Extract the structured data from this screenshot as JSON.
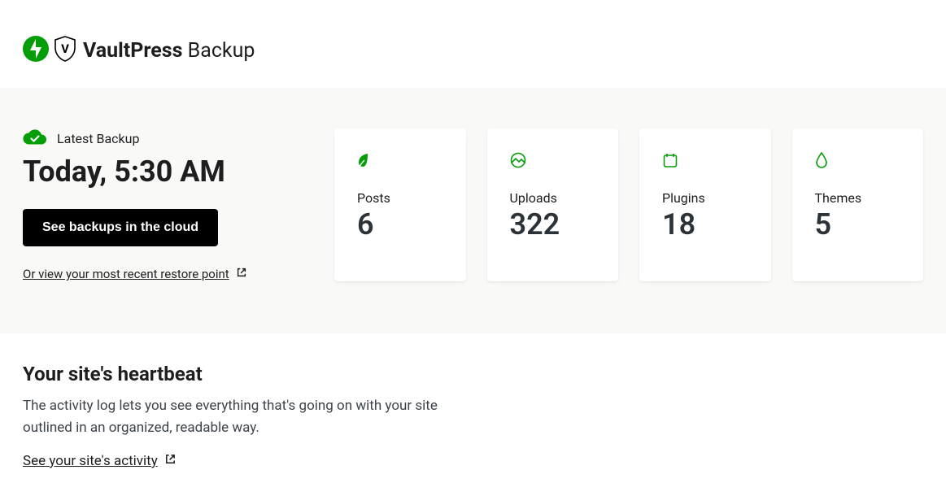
{
  "header": {
    "brand_bold": "VaultPress",
    "brand_light": " Backup"
  },
  "backup": {
    "latest_label": "Latest Backup",
    "timestamp": "Today, 5:30 AM",
    "cta_label": "See backups in the cloud",
    "restore_link": "Or view your most recent restore point"
  },
  "stats": [
    {
      "icon": "posts",
      "label": "Posts",
      "value": "6"
    },
    {
      "icon": "uploads",
      "label": "Uploads",
      "value": "322"
    },
    {
      "icon": "plugins",
      "label": "Plugins",
      "value": "18"
    },
    {
      "icon": "themes",
      "label": "Themes",
      "value": "5"
    }
  ],
  "heartbeat": {
    "title": "Your site's heartbeat",
    "description": "The activity log lets you see everything that's going on with your site outlined in an organized, readable way.",
    "link": "See your site's activity"
  }
}
